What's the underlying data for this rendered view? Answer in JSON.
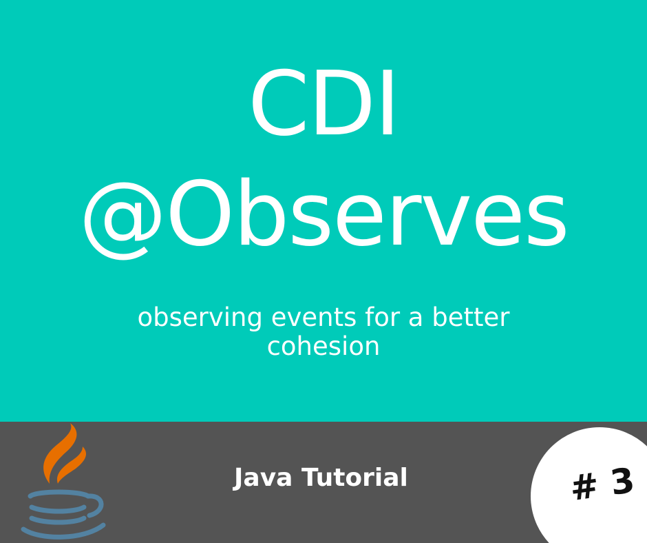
{
  "title": {
    "line1": "CDI",
    "line2": "@Observes"
  },
  "subtitle": {
    "line1": "observing events for a better",
    "line2": "cohesion"
  },
  "footer": {
    "label": "Java Tutorial",
    "badge": "# 3"
  },
  "logo": {
    "icon": "java-coffee-cup-icon",
    "flame_color": "#e76f00",
    "cup_color": "#5382a1"
  },
  "colors": {
    "top_background": "#00cbb9",
    "bottom_background": "#545454",
    "text": "#ffffff",
    "badge_background": "#ffffff",
    "badge_text": "#111111"
  }
}
